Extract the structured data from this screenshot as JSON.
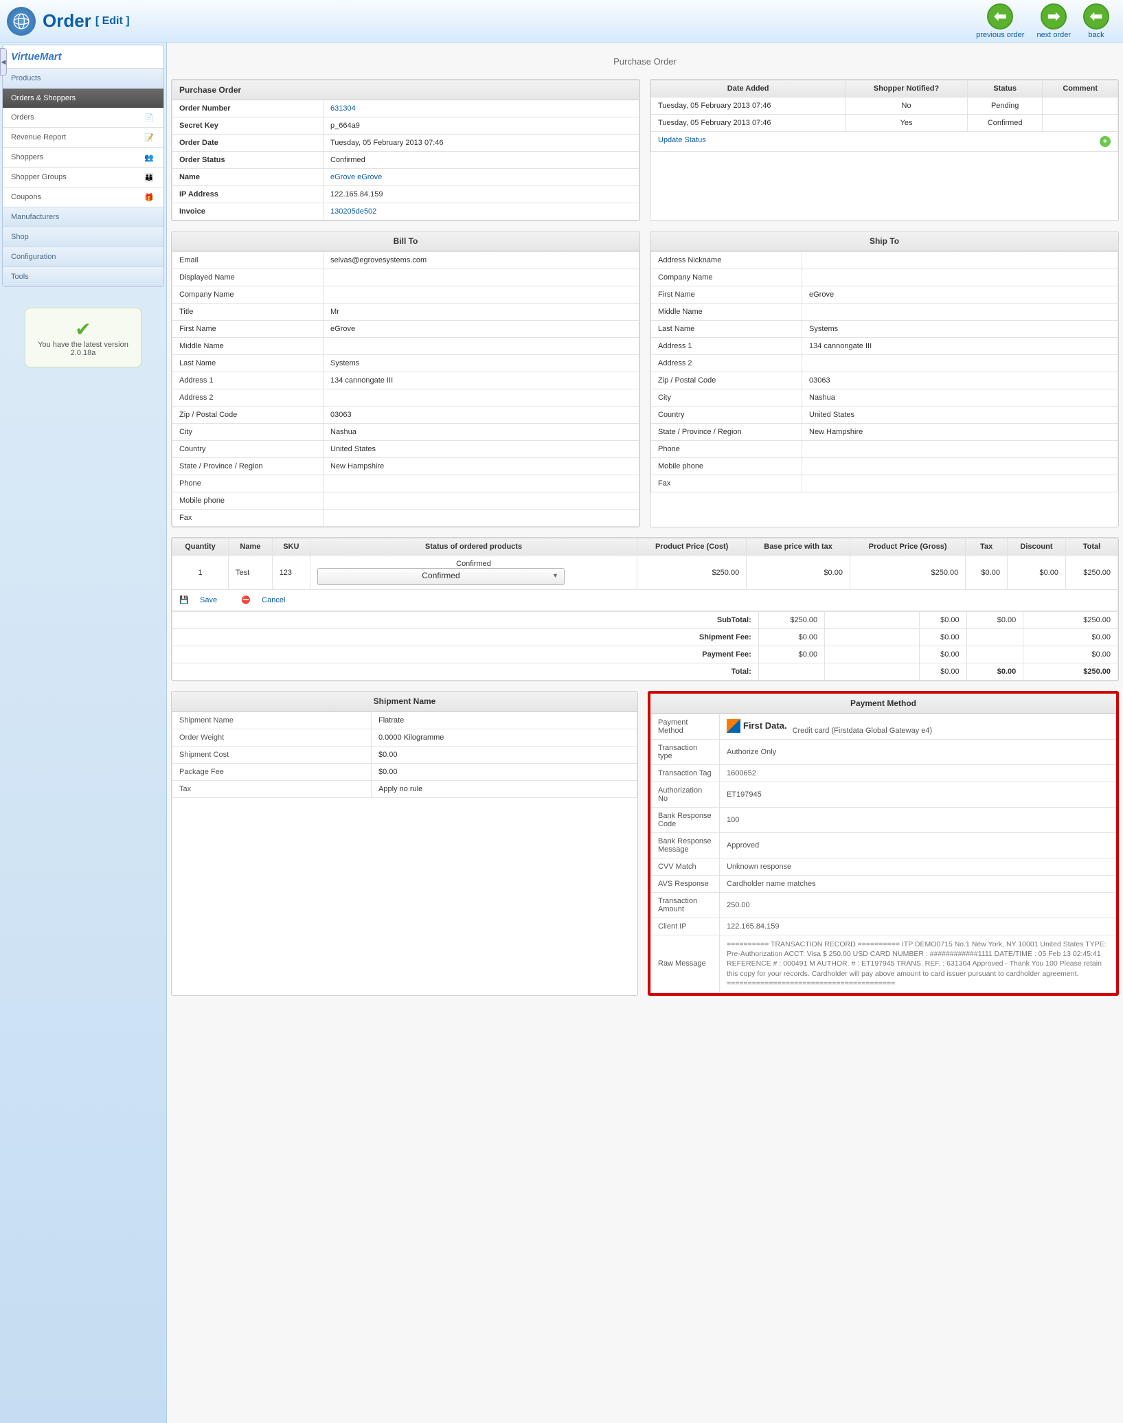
{
  "header": {
    "title": "Order",
    "edit": "[ Edit ]",
    "toolbar": {
      "prev": "previous order",
      "next": "next order",
      "back": "back"
    }
  },
  "sidebar": {
    "logo": "VirtueMart",
    "sections": {
      "products": "Products",
      "orders_shoppers": "Orders & Shoppers",
      "manufacturers": "Manufacturers",
      "shop": "Shop",
      "configuration": "Configuration",
      "tools": "Tools"
    },
    "items": {
      "orders": "Orders",
      "revenue": "Revenue Report",
      "shoppers": "Shoppers",
      "groups": "Shopper Groups",
      "coupons": "Coupons"
    },
    "version": {
      "line1": "You have the latest version",
      "line2": "2.0.18a"
    }
  },
  "page_title": "Purchase Order",
  "purchase": {
    "head": "Purchase Order",
    "rows": {
      "order_number_l": "Order Number",
      "order_number_v": "631304",
      "secret_l": "Secret Key",
      "secret_v": "p_664a9",
      "date_l": "Order Date",
      "date_v": "Tuesday, 05 February 2013 07:46",
      "status_l": "Order Status",
      "status_v": "Confirmed",
      "name_l": "Name",
      "name_v": "eGrove eGrove",
      "ip_l": "IP Address",
      "ip_v": "122.165.84.159",
      "invoice_l": "Invoice",
      "invoice_v": "130205de502"
    }
  },
  "history": {
    "th": {
      "date": "Date Added",
      "notified": "Shopper Notified?",
      "status": "Status",
      "comment": "Comment"
    },
    "rows": [
      {
        "date": "Tuesday, 05 February 2013 07:46",
        "notified": "No",
        "status": "Pending",
        "comment": ""
      },
      {
        "date": "Tuesday, 05 February 2013 07:46",
        "notified": "Yes",
        "status": "Confirmed",
        "comment": ""
      }
    ],
    "update": "Update Status"
  },
  "billto": {
    "head": "Bill To",
    "email_l": "Email",
    "email_v": "selvas@egrovesystems.com",
    "dname_l": "Displayed Name",
    "dname_v": "",
    "cname_l": "Company Name",
    "cname_v": "",
    "title_l": "Title",
    "title_v": "Mr",
    "fname_l": "First Name",
    "fname_v": "eGrove",
    "mname_l": "Middle Name",
    "mname_v": "",
    "lname_l": "Last Name",
    "lname_v": "Systems",
    "addr1_l": "Address 1",
    "addr1_v": "134 cannongate III",
    "addr2_l": "Address 2",
    "addr2_v": "",
    "zip_l": "Zip / Postal Code",
    "zip_v": "03063",
    "city_l": "City",
    "city_v": "Nashua",
    "country_l": "Country",
    "country_v": "United States",
    "state_l": "State / Province / Region",
    "state_v": "New Hampshire",
    "phone_l": "Phone",
    "phone_v": "",
    "mobile_l": "Mobile phone",
    "mobile_v": "",
    "fax_l": "Fax",
    "fax_v": ""
  },
  "shipto": {
    "head": "Ship To",
    "nick_l": "Address Nickname",
    "nick_v": "",
    "cname_l": "Company Name",
    "cname_v": "",
    "fname_l": "First Name",
    "fname_v": "eGrove",
    "mname_l": "Middle Name",
    "mname_v": "",
    "lname_l": "Last Name",
    "lname_v": "Systems",
    "addr1_l": "Address 1",
    "addr1_v": "134 cannongate III",
    "addr2_l": "Address 2",
    "addr2_v": "",
    "zip_l": "Zip / Postal Code",
    "zip_v": "03063",
    "city_l": "City",
    "city_v": "Nashua",
    "country_l": "Country",
    "country_v": "United States",
    "state_l": "State / Province / Region",
    "state_v": "New Hampshire",
    "phone_l": "Phone",
    "phone_v": "",
    "mobile_l": "Mobile phone",
    "mobile_v": "",
    "fax_l": "Fax",
    "fax_v": ""
  },
  "products": {
    "th": {
      "qty": "Quantity",
      "name": "Name",
      "sku": "SKU",
      "status": "Status of ordered products",
      "cost": "Product Price (Cost)",
      "base": "Base price with tax",
      "gross": "Product Price (Gross)",
      "tax": "Tax",
      "discount": "Discount",
      "total": "Total"
    },
    "row": {
      "qty": "1",
      "name": "Test",
      "sku": "123",
      "status": "Confirmed",
      "select": "Confirmed",
      "cost": "$250.00",
      "base": "$0.00",
      "gross": "$250.00",
      "tax": "$0.00",
      "discount": "$0.00",
      "total": "$250.00"
    },
    "save": "Save",
    "cancel": "Cancel",
    "totals": {
      "subtotal_l": "SubTotal:",
      "subtotal_v": "$250.00",
      "subtotal_tax": "$0.00",
      "subtotal_disc": "$0.00",
      "subtotal_tot": "$250.00",
      "ship_l": "Shipment Fee:",
      "ship_v": "$0.00",
      "ship_tax": "$0.00",
      "ship_tot": "$0.00",
      "pay_l": "Payment Fee:",
      "pay_v": "$0.00",
      "pay_tax": "$0.00",
      "pay_tot": "$0.00",
      "total_l": "Total:",
      "total_v": "$0.00",
      "total_disc": "$0.00",
      "total_tot": "$250.00"
    }
  },
  "shipment": {
    "head": "Shipment Name",
    "name_l": "Shipment Name",
    "name_v": "Flatrate",
    "weight_l": "Order Weight",
    "weight_v": "0.0000 Kilogramme",
    "cost_l": "Shipment Cost",
    "cost_v": "$0.00",
    "pkg_l": "Package Fee",
    "pkg_v": "$0.00",
    "tax_l": "Tax",
    "tax_v": "Apply no rule"
  },
  "payment": {
    "head": "Payment Method",
    "method_l": "Payment Method",
    "method_logo": "First Data.",
    "method_v": "Credit card (Firstdata Global Gateway e4)",
    "ttype_l": "Transaction type",
    "ttype_v": "Authorize Only",
    "ttag_l": "Transaction Tag",
    "ttag_v": "1600652",
    "auth_l": "Authorization No",
    "auth_v": "ET197945",
    "brcode_l": "Bank Response Code",
    "brcode_v": "100",
    "brmsg_l": "Bank Response Message",
    "brmsg_v": "Approved",
    "cvv_l": "CVV Match",
    "cvv_v": "Unknown response",
    "avs_l": "AVS Response",
    "avs_v": "Cardholder name matches",
    "amt_l": "Transaction Amount",
    "amt_v": "250.00",
    "ip_l": "Client IP",
    "ip_v": "122.165.84.159",
    "raw_l": "Raw Message",
    "raw_v": "========== TRANSACTION RECORD ========== ITP DEMO0715 No.1 New York, NY 10001 United States TYPE: Pre-Authorization ACCT: Visa $ 250.00 USD CARD NUMBER : ############1111 DATE/TIME : 05 Feb 13 02:45:41 REFERENCE # : 000491 M AUTHOR. # : ET197945 TRANS. REF. : 631304 Approved - Thank You 100 Please retain this copy for your records. Cardholder will pay above amount to card issuer pursuant to cardholder agreement. ========================================"
  }
}
